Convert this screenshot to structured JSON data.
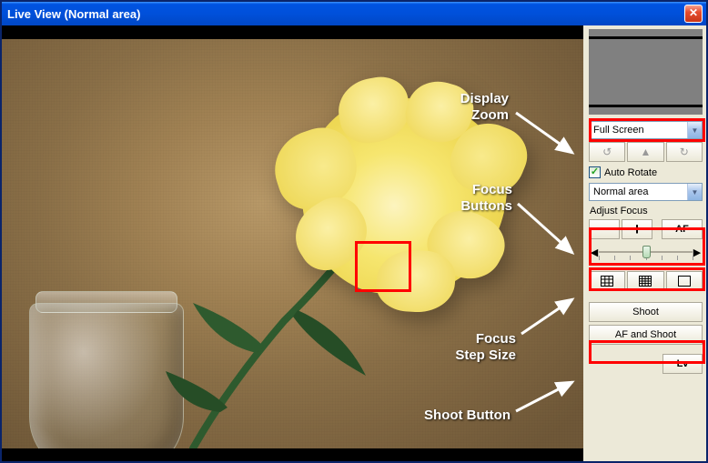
{
  "window": {
    "title": "Live View (Normal area)"
  },
  "annotations": {
    "display_zoom": "Display\nZoom",
    "focus_buttons": "Focus\nButtons",
    "focus_step": "Focus\nStep Size",
    "shoot_button": "Shoot Button"
  },
  "sidebar": {
    "zoom_combo": "Full Screen",
    "auto_rotate_label": "Auto Rotate",
    "auto_rotate_checked": true,
    "area_combo": "Normal area",
    "adjust_focus_label": "Adjust Focus",
    "minus": "−",
    "plus": "+",
    "af": "AF",
    "slider_value": 0.5,
    "shoot": "Shoot",
    "af_shoot": "AF and Shoot",
    "lv": "Lv"
  }
}
